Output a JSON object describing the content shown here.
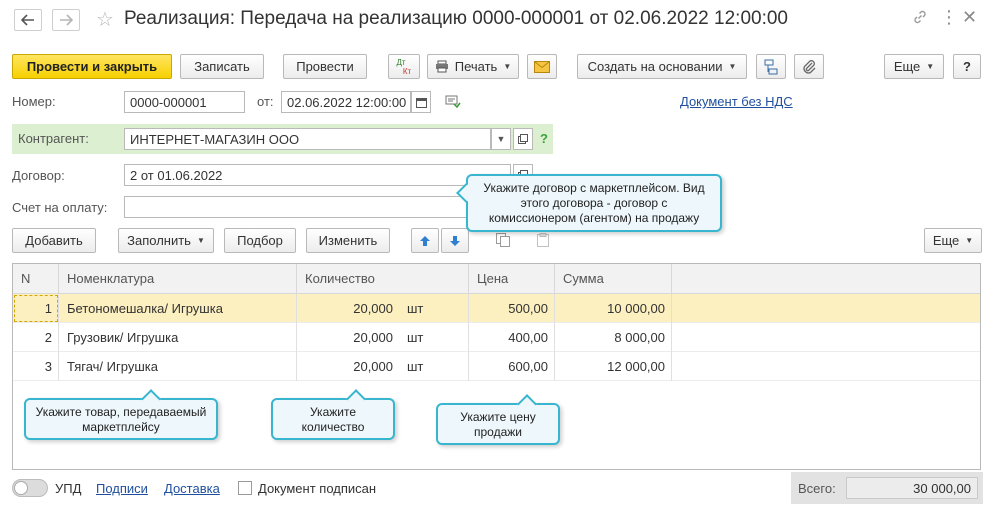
{
  "window": {
    "title": "Реализация: Передача на реализацию 0000-000001 от 02.06.2022 12:00:00",
    "back_icon": "arrow-left-icon",
    "forward_icon": "arrow-right-icon",
    "favorite_icon": "star-icon",
    "link_icon": "link-icon",
    "menu_icon": "more-vertical-icon",
    "close_icon": "close-icon"
  },
  "toolbar": {
    "post_and_close": "Провести и закрыть",
    "save": "Записать",
    "post": "Провести",
    "dt_kt_top": "Дт",
    "dt_kt_bottom": "Кт",
    "print": "Печать",
    "create_based_on": "Создать на основании",
    "more": "Еще",
    "help": "?"
  },
  "header": {
    "number_label": "Номер:",
    "number_value": "0000-000001",
    "date_label": "от:",
    "date_value": "02.06.2022 12:00:00",
    "vat_link": "Документ без НДС",
    "counterparty_label": "Контрагент:",
    "counterparty_value": "ИНТЕРНЕТ-МАГАЗИН ООО",
    "counterparty_help": "?",
    "contract_label": "Договор:",
    "contract_value": "2 от 01.06.2022",
    "invoice_label": "Счет на оплату:",
    "invoice_value": ""
  },
  "table_toolbar": {
    "add": "Добавить",
    "fill": "Заполнить",
    "pick": "Подбор",
    "change": "Изменить",
    "more": "Еще"
  },
  "table": {
    "columns": [
      "N",
      "Номенклатура",
      "Количество",
      "Цена",
      "Сумма"
    ],
    "rows": [
      {
        "n": "1",
        "item": "Бетономешалка/ Игрушка",
        "qty": "20,000",
        "unit": "шт",
        "price": "500,00",
        "sum": "10 000,00"
      },
      {
        "n": "2",
        "item": "Грузовик/ Игрушка",
        "qty": "20,000",
        "unit": "шт",
        "price": "400,00",
        "sum": "8 000,00"
      },
      {
        "n": "3",
        "item": "Тягач/ Игрушка",
        "qty": "20,000",
        "unit": "шт",
        "price": "600,00",
        "sum": "12 000,00"
      }
    ]
  },
  "tooltips": {
    "contract": "Укажите договор с маркетплейсом. Вид этого договора - договор с комиссионером (агентом) на продажу",
    "item": "Укажите товар, передаваемый маркетплейсу",
    "qty": "Укажите количество",
    "price": "Укажите цену продажи"
  },
  "footer": {
    "upd": "УПД",
    "signatures": "Подписи",
    "delivery": "Доставка",
    "signed_label": "Документ подписан",
    "total_label": "Всего:",
    "total_value": "30 000,00"
  },
  "colors": {
    "primary_button": "#f7d100",
    "selected_row": "#fcefc0",
    "counterparty_band": "#dcefd0",
    "tooltip_border": "#38b6cf",
    "link": "#1f4f9e"
  }
}
